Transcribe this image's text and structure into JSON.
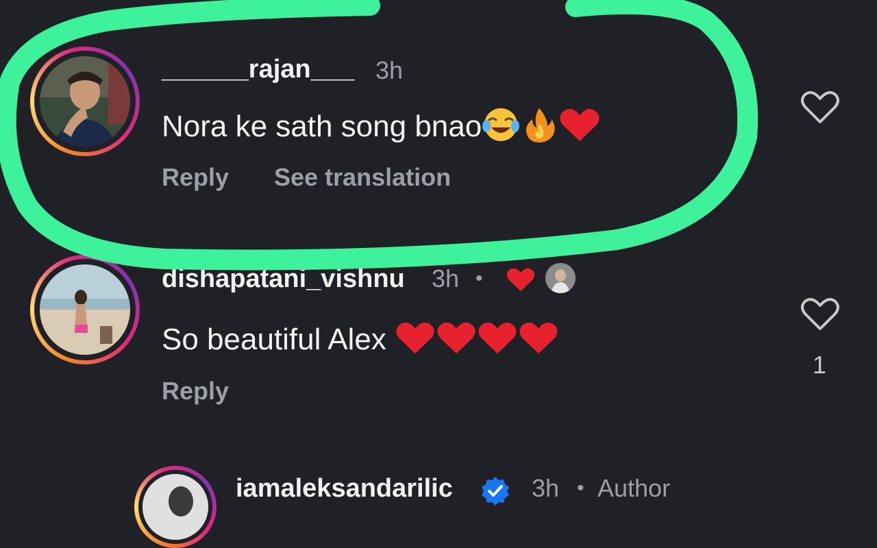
{
  "comments": [
    {
      "username": "______rajan___",
      "time": "3h",
      "text": "Nora ke sath song bnao",
      "emojis": [
        "face-with-tears-of-joy",
        "fire",
        "red-heart"
      ],
      "actions": {
        "reply": "Reply",
        "translate": "See translation"
      },
      "highlighted": true
    },
    {
      "username": "dishapatani_vishnu",
      "time": "3h",
      "separator": "•",
      "text": "So beautiful Alex",
      "emojis": [
        "red-heart",
        "red-heart",
        "red-heart",
        "red-heart"
      ],
      "actions": {
        "reply": "Reply"
      },
      "like_count": "1",
      "liked_by_author": true
    },
    {
      "username": "iamaleksandarilic",
      "verified": true,
      "time": "3h",
      "separator": "•",
      "role": "Author"
    }
  ],
  "colors": {
    "background": "#1f2127",
    "highlight_stroke": "#3ef29b",
    "heart": "#e8212e",
    "verified": "#1877f2"
  }
}
